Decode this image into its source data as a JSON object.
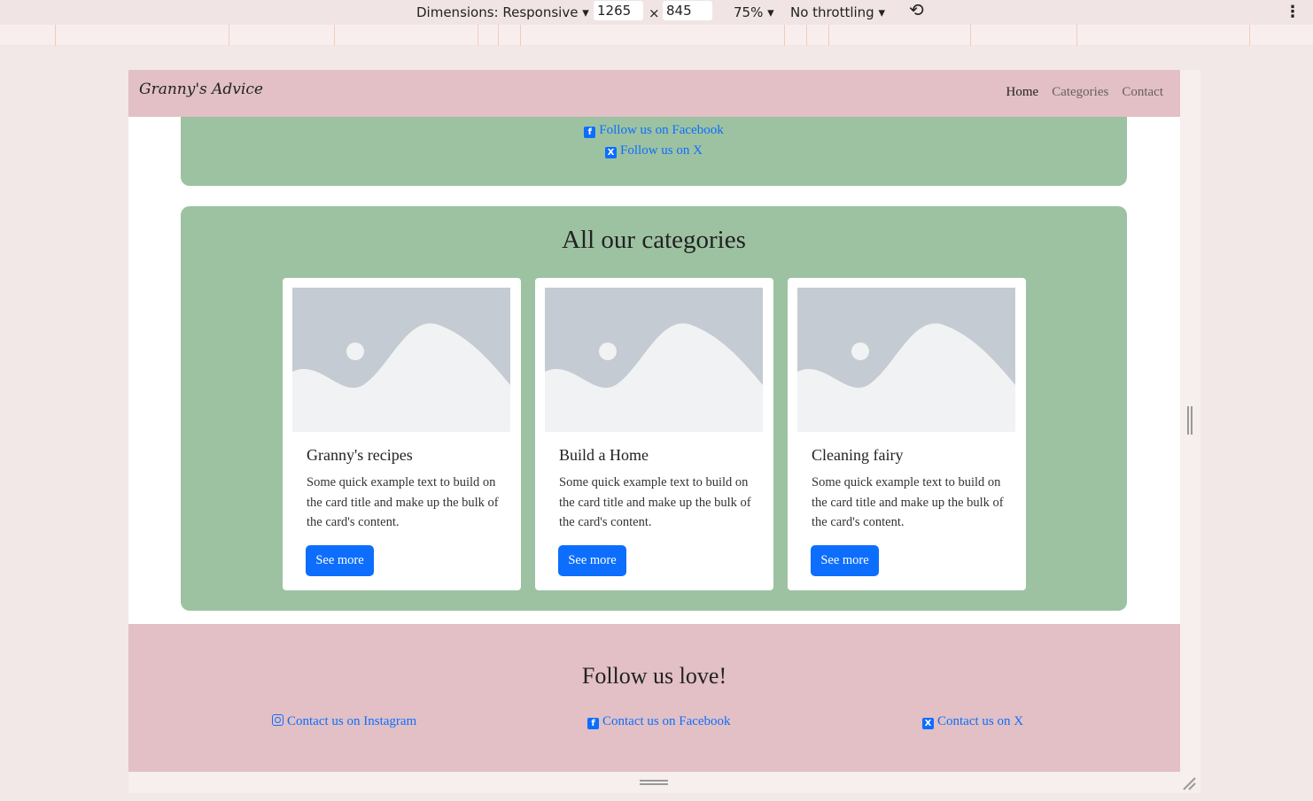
{
  "devtools": {
    "dimensions_label": "Dimensions: Responsive",
    "width_value": "1265",
    "times": "×",
    "height_value": "845",
    "zoom": "75%",
    "throttling": "No throttling",
    "caret": "▾",
    "more": "⋮",
    "rotate_icon": "⟲"
  },
  "navbar": {
    "brand": "Granny's Advice",
    "links": [
      "Home",
      "Categories",
      "Contact"
    ]
  },
  "top_panel": {
    "links": [
      "Follow us on Facebook",
      "Follow us on X"
    ]
  },
  "categories": {
    "title": "All our categories",
    "cards": [
      {
        "title": "Granny's recipes",
        "text": "Some quick example text to build on the card title and make up the bulk of the card's content.",
        "button": "See more"
      },
      {
        "title": "Build a Home",
        "text": "Some quick example text to build on the card title and make up the bulk of the card's content.",
        "button": "See more"
      },
      {
        "title": "Cleaning fairy",
        "text": "Some quick example text to build on the card title and make up the bulk of the card's content.",
        "button": "See more"
      }
    ]
  },
  "footer": {
    "title": "Follow us love!",
    "links": [
      "Contact us on Instagram",
      "Contact us on Facebook",
      "Contact us on X"
    ]
  },
  "colors": {
    "navbar_bg": "#e2c0c5",
    "panel_green": "#9dc2a2",
    "link_blue": "#0d6efd",
    "button_blue": "#0d6efd"
  }
}
